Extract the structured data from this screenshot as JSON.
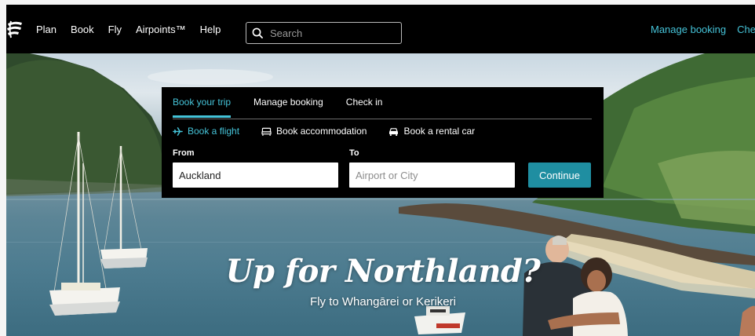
{
  "nav": {
    "items": [
      {
        "label": "Plan"
      },
      {
        "label": "Book"
      },
      {
        "label": "Fly"
      },
      {
        "label": "Airpoints™"
      },
      {
        "label": "Help"
      }
    ],
    "search": {
      "placeholder": "Search",
      "icon": "search-icon"
    },
    "right_links": [
      {
        "label": "Manage booking"
      },
      {
        "label": "Chec"
      }
    ]
  },
  "booking": {
    "tabs": [
      {
        "label": "Book your trip",
        "active": true
      },
      {
        "label": "Manage booking",
        "active": false
      },
      {
        "label": "Check in",
        "active": false
      }
    ],
    "subtabs": [
      {
        "label": "Book a flight",
        "icon": "plane-icon",
        "active": true
      },
      {
        "label": "Book accommodation",
        "icon": "bed-icon",
        "active": false
      },
      {
        "label": "Book a rental car",
        "icon": "car-icon",
        "active": false
      }
    ],
    "from": {
      "label": "From",
      "value": "Auckland"
    },
    "to": {
      "label": "To",
      "placeholder": "Airport or City"
    },
    "continue_label": "Continue"
  },
  "hero": {
    "title": "Up for Northland?",
    "subtitle": "Fly to Whangārei or Kerikeri"
  },
  "colors": {
    "accent": "#45c3d8",
    "button": "#1f8ea1",
    "nav_bg": "#000000"
  }
}
